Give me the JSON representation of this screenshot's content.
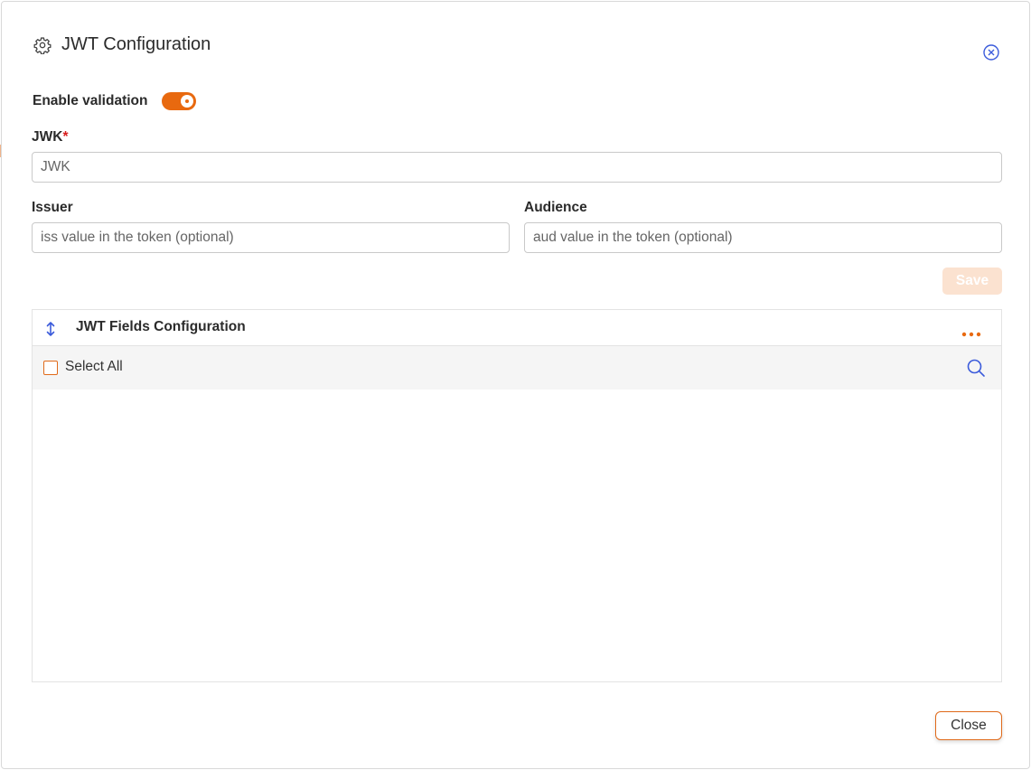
{
  "dialog": {
    "title": "JWT Configuration",
    "icon": "settings-gear-icon",
    "close_icon": "close-circle-icon"
  },
  "validation": {
    "label": "Enable validation",
    "enabled": true
  },
  "jwk": {
    "label": "JWK",
    "required_marker": "*",
    "placeholder": "JWK",
    "value": ""
  },
  "issuer": {
    "label": "Issuer",
    "placeholder": "iss value in the token (optional)",
    "value": ""
  },
  "audience": {
    "label": "Audience",
    "placeholder": "aud value in the token (optional)",
    "value": ""
  },
  "save_button": {
    "label": "Save",
    "disabled": true
  },
  "fields_panel": {
    "title": "JWT Fields Configuration",
    "sort_icon": "sort-vertical-icon",
    "more_icon": "more-horizontal-icon",
    "select_all_label": "Select All",
    "select_all_checked": false,
    "search_icon": "search-icon",
    "items": []
  },
  "close_button": {
    "label": "Close"
  },
  "colors": {
    "accent": "#e8690f",
    "accent_light": "#fbe2d0",
    "icon_blue": "#3b5bdb",
    "required": "#d81e1e"
  }
}
